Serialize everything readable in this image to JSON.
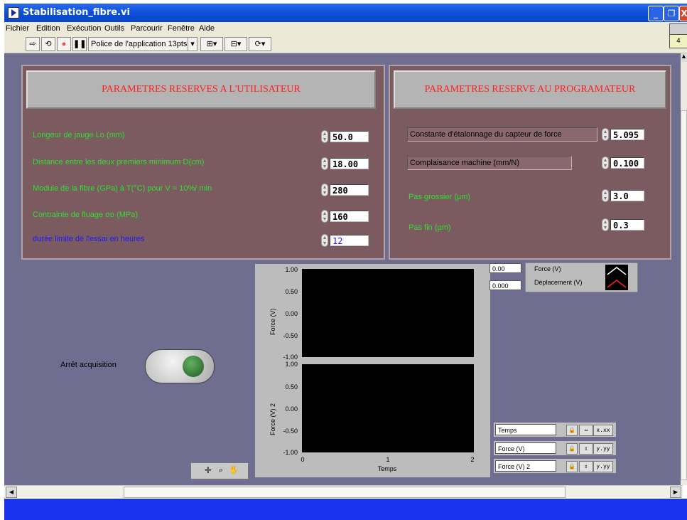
{
  "window": {
    "title": "Stabilisation_fibre.vi",
    "minimize": "_",
    "restore": "❐",
    "close": "X"
  },
  "menu": [
    "Fichier",
    "Edition",
    "Exécution",
    "Outils",
    "Parcourir",
    "Fenêtre",
    "Aide"
  ],
  "toolbar": {
    "font_select": "Police de l'application 13pts",
    "icon_badge": "4"
  },
  "user_section": {
    "title": "PARAMETRES RESERVES A L'UTILISATEUR",
    "params": [
      {
        "label": "Longeur de jauge Lo (mm)",
        "value": "50.0"
      },
      {
        "label": "Distance entre les deux premiers minimum D(cm)",
        "value": "18.00"
      },
      {
        "label": "Module de la fibre (GPa) à T(°C) pour V = 10%/ min",
        "value": "280"
      },
      {
        "label": "Contrainte de fluage σo (MPa)",
        "value": "160"
      },
      {
        "label": "durée limite de l'essai en heures",
        "value": "12"
      }
    ]
  },
  "prog_section": {
    "title": "PARAMETRES RESERVE AU PROGRAMATEUR",
    "params": [
      {
        "label": "Constante d'étalonnage du capteur de force",
        "value": "5.095"
      },
      {
        "label": "Complaisance machine (mm/N)",
        "value": "0.100"
      },
      {
        "label": "Pas grossier (µm)",
        "value": "3.0"
      },
      {
        "label": "Pas fin (µm)",
        "value": "0.3"
      }
    ]
  },
  "stop_button": {
    "label": "Arrêt acquisition"
  },
  "graph": {
    "xlabel": "Temps",
    "top_ylabel": "Force (V)",
    "bottom_ylabel": "Force (V) 2",
    "top_yticks": [
      "1.00",
      "0.50",
      "0.00",
      "-0.50",
      "-1.00"
    ],
    "bottom_yticks": [
      "1.00",
      "0.50",
      "0.00",
      "-0.50",
      "-1.00"
    ],
    "xticks": [
      "0",
      "1",
      "2"
    ],
    "cursor_x": "0.00",
    "cursor_y": "0.000",
    "legend": [
      {
        "name": "Force (V)",
        "color": "#ffffff"
      },
      {
        "name": "Déplacement (V)",
        "color": "#ff2020"
      }
    ]
  },
  "scale_legend": [
    {
      "name": "Temps",
      "fmt": "x.xx"
    },
    {
      "name": "Force (V)",
      "fmt": "y.yy"
    },
    {
      "name": "Force (V) 2",
      "fmt": "y.yy"
    }
  ]
}
